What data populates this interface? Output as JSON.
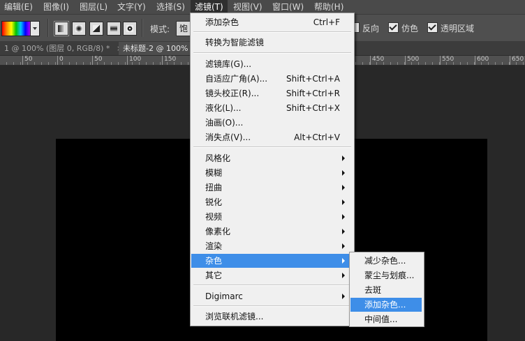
{
  "menubar": {
    "items": [
      "编辑(E)",
      "图像(I)",
      "图层(L)",
      "文字(Y)",
      "选择(S)",
      "滤镜(T)",
      "视图(V)",
      "窗口(W)",
      "帮助(H)"
    ]
  },
  "options_bar": {
    "mode_label": "模式:",
    "mode_value": "饱",
    "checkboxes": [
      {
        "label": "反向",
        "checked": false
      },
      {
        "label": "仿色",
        "checked": true
      },
      {
        "label": "透明区域",
        "checked": true
      }
    ]
  },
  "tabs": [
    {
      "label": "1 @ 100% (图层 0, RGB/8) *",
      "close": "×"
    },
    {
      "label": "未标题-2 @ 100%",
      "close": "×"
    }
  ],
  "ruler": {
    "labels": [
      "50",
      "0",
      "50",
      "100",
      "150",
      "450",
      "500",
      "550",
      "600",
      "650"
    ]
  },
  "filter_menu": {
    "items": [
      {
        "label": "添加杂色",
        "shortcut": "Ctrl+F"
      },
      {
        "label": "转换为智能滤镜",
        "shortcut": ""
      },
      {
        "label": "滤镜库(G)...",
        "shortcut": ""
      },
      {
        "label": "自适应广角(A)...",
        "shortcut": "Shift+Ctrl+A"
      },
      {
        "label": "镜头校正(R)...",
        "shortcut": "Shift+Ctrl+R"
      },
      {
        "label": "液化(L)...",
        "shortcut": "Shift+Ctrl+X"
      },
      {
        "label": "油画(O)...",
        "shortcut": ""
      },
      {
        "label": "消失点(V)...",
        "shortcut": "Alt+Ctrl+V"
      },
      {
        "label": "风格化",
        "shortcut": ""
      },
      {
        "label": "模糊",
        "shortcut": ""
      },
      {
        "label": "扭曲",
        "shortcut": ""
      },
      {
        "label": "锐化",
        "shortcut": ""
      },
      {
        "label": "视频",
        "shortcut": ""
      },
      {
        "label": "像素化",
        "shortcut": ""
      },
      {
        "label": "渲染",
        "shortcut": ""
      },
      {
        "label": "杂色",
        "shortcut": ""
      },
      {
        "label": "其它",
        "shortcut": ""
      },
      {
        "label": "Digimarc",
        "shortcut": ""
      },
      {
        "label": "浏览联机滤镜...",
        "shortcut": ""
      }
    ]
  },
  "noise_submenu": {
    "items": [
      "减少杂色...",
      "蒙尘与划痕...",
      "去斑",
      "添加杂色...",
      "中间值..."
    ]
  },
  "colors": {
    "highlight": "#3e8ee8",
    "menubar_bg": "#4a4a4a",
    "workspace_bg": "#282828",
    "canvas": "#000000"
  }
}
